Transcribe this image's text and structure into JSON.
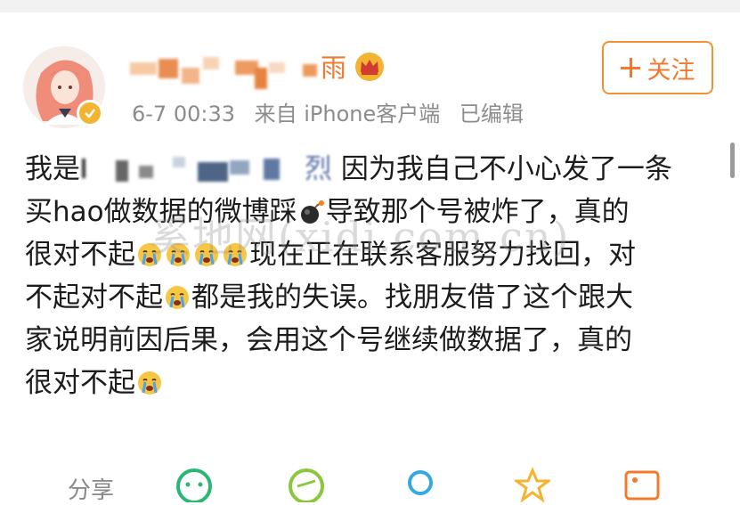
{
  "post": {
    "author": {
      "name_visible": "雨",
      "verified": true
    },
    "meta": {
      "date": "6-7 00:33",
      "source": "来自 iPhone客户端",
      "edited": "已编辑"
    },
    "follow_label": "关注",
    "body": {
      "line1_start": "我是",
      "line1_masked_end": "烈",
      "line1_rest": "因为我自己不小心发了一条",
      "line2a": "买hao做数据的微博踩",
      "line2b": "导致那个号被炸了，真的",
      "line3a": "很对不起",
      "line3b": "现在正在联系客服努力找回，对",
      "line4a": "不起对不起",
      "line4b": "都是我的失误。找朋友借了这个跟大",
      "line5": "家说明前因后果，会用这个号继续做数据了，真的",
      "line6": "很对不起"
    },
    "watermark": "奚地网(xidi.com.cn)",
    "actions": {
      "share_label": "分享"
    }
  },
  "colors": {
    "accent": "#f07a2f",
    "meta_text": "#8c8c8c",
    "badge": "#f3b531"
  },
  "icons": [
    "crown-icon",
    "verified-icon",
    "plus-icon",
    "bomb-icon",
    "crying-face-icon",
    "comment-icon",
    "repost-icon",
    "like-icon",
    "star-icon",
    "image-icon"
  ]
}
